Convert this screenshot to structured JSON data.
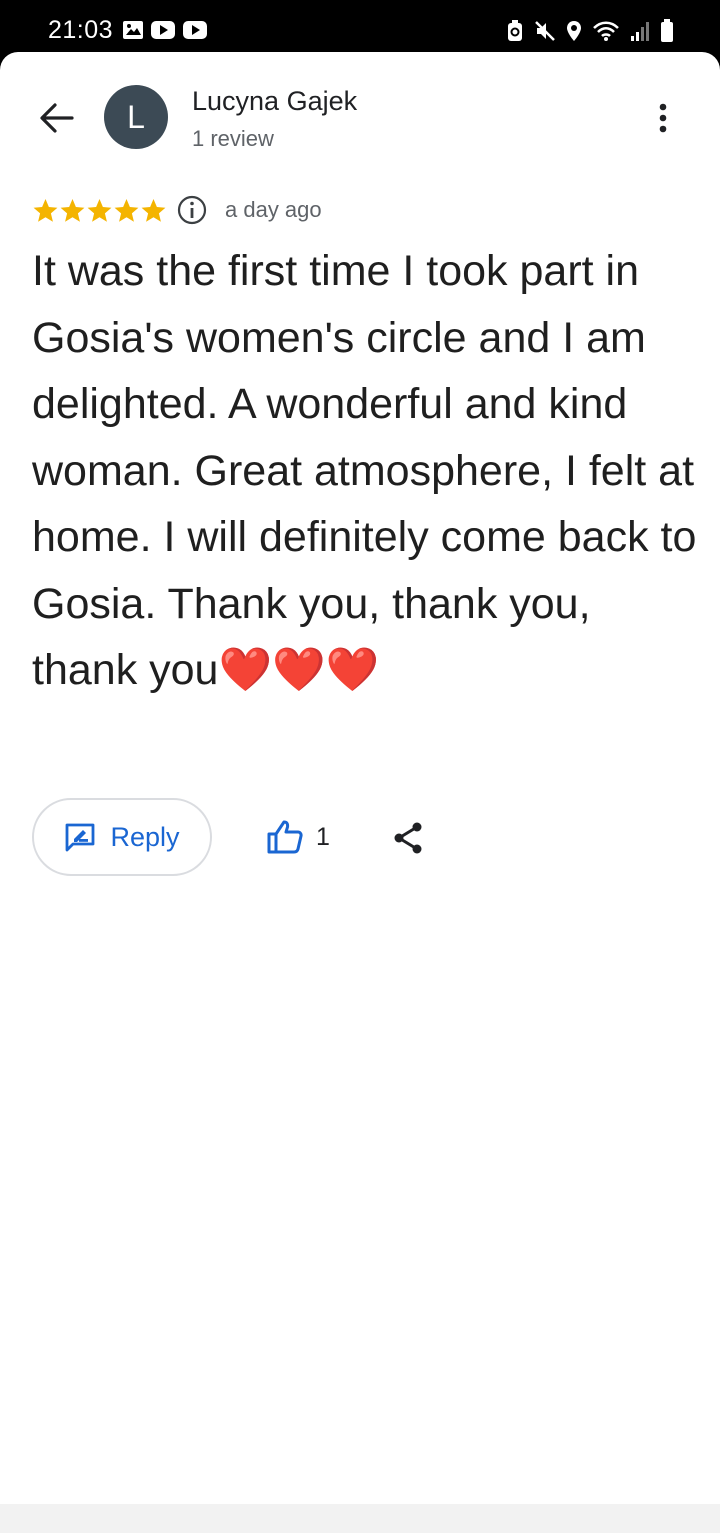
{
  "status_bar": {
    "time": "21:03",
    "left_icons": [
      "gallery-notification-icon",
      "youtube-notification-icon",
      "youtube-notification-icon"
    ],
    "right_icons": [
      "battery-saver-icon",
      "mute-icon",
      "location-icon",
      "wifi-icon",
      "signal-icon",
      "battery-icon"
    ]
  },
  "header": {
    "avatar_letter": "L",
    "reviewer_name": "Lucyna Gajek",
    "review_count": "1 review"
  },
  "review": {
    "stars": 5,
    "time_ago": "a day ago",
    "text": "It was the first time I took part in Gosia's women's circle and I am delighted. A wonderful and kind woman. Great atmosphere, I felt at home. I will definitely come back to Gosia. Thank you, thank you, thank you❤️❤️❤️"
  },
  "actions": {
    "reply_label": "Reply",
    "like_count": "1"
  },
  "colors": {
    "star": "#f4b400",
    "accent": "#1a66d2",
    "avatar_bg": "#3c4a55"
  }
}
